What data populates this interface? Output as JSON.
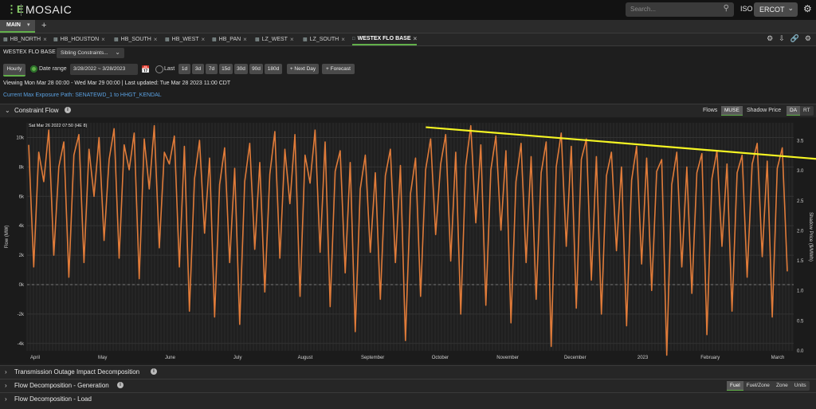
{
  "app": {
    "logo_mark": "⋮E",
    "name": "MOSAIC"
  },
  "search": {
    "placeholder": "Search..."
  },
  "iso": {
    "label": "ISO",
    "value": "ERCOT"
  },
  "main_tab": {
    "label": "MAIN"
  },
  "tabs": [
    "HB_NORTH",
    "HB_HOUSTON",
    "HB_SOUTH",
    "HB_WEST",
    "HB_PAN",
    "LZ_WEST",
    "LZ_SOUTH",
    "WESTEX FLO BASE"
  ],
  "active_tab": "WESTEX FLO BASE",
  "toolbar": {
    "constraint_name": "WESTEX FLO BASE",
    "sibling_select": "Sibling Constraints...",
    "hourly": "Hourly",
    "date_range_label": "Date range",
    "date_range_value": "3/28/2022 ~ 3/28/2023",
    "last_label": "Last",
    "last_options": [
      "1d",
      "3d",
      "7d",
      "15d",
      "30d",
      "90d",
      "180d"
    ],
    "next_day": "+ Next Day",
    "forecast": "+ Forecast"
  },
  "info": {
    "viewing": "Viewing Mon Mar 28 00:00 - Wed Mar 29 00:00 | Last updated: Tue Mar 28 2023 11:00 CDT",
    "exposure_path": "Current Max Exposure Path: SENATEWD_1 to HHGT_KENDAL"
  },
  "constraint_flow": {
    "title": "Constraint Flow",
    "flows_label": "Flows",
    "flows_option": "MUSE",
    "shadow_label": "Shadow Price",
    "shadow_options": [
      "DA",
      "RT"
    ]
  },
  "chart_data": {
    "type": "line",
    "legend_text": "Sat Mar 26 2022 07:50 (HE 8)",
    "ylabel": "Flow (MW)",
    "y2label": "Shadow Price ($/MWh)",
    "ylim": [
      -4500,
      11000
    ],
    "y2lim": [
      0.0,
      3.8
    ],
    "yticks": [
      "10k",
      "8k",
      "6k",
      "4k",
      "2k",
      "0k",
      "-2k",
      "-4k"
    ],
    "y2ticks": [
      "3.5",
      "3.0",
      "2.5",
      "2.0",
      "1.5",
      "1.0",
      "0.5",
      "0.0"
    ],
    "xticks": [
      "April",
      "May",
      "June",
      "July",
      "August",
      "September",
      "October",
      "November",
      "December",
      "2023",
      "February",
      "March"
    ],
    "series_color": "#e07b39",
    "trend_color": "#f5f523",
    "trend": {
      "x": [
        "October",
        "March"
      ],
      "y": [
        10700,
        8500
      ]
    },
    "series": [
      {
        "values": [
          9500,
          1200,
          9000,
          7000,
          10500,
          2000,
          8000,
          9700,
          500,
          8800,
          10200,
          1500,
          9200,
          6000,
          10000,
          3000,
          8500,
          10600,
          1800,
          9500,
          7800,
          10300,
          400,
          9900,
          6500,
          10800,
          2500,
          9000,
          8200,
          10100,
          1200,
          9400,
          -1800,
          7200,
          9800,
          3500,
          8600,
          -2200,
          6800,
          9300,
          1500,
          7900,
          -2700,
          7000,
          9600,
          2400,
          8300,
          -500,
          7500,
          10400,
          1800,
          9200,
          5500,
          10200,
          -800,
          8800,
          6900,
          10500,
          2200,
          9700,
          -1500,
          7700,
          9100,
          800,
          8300,
          -3200,
          6500,
          8800,
          2200,
          7600,
          -1000,
          7400,
          9200,
          1500,
          8100,
          -3800,
          6200,
          8600,
          -800,
          7800,
          9900,
          3400,
          8200,
          10200,
          1600,
          9000,
          -2000,
          8100,
          10800,
          4200,
          9500,
          -1400,
          7800,
          10100,
          3700,
          9100,
          -2600,
          7000,
          9600,
          1500,
          8700,
          -1000,
          7600,
          9700,
          -4200,
          8000,
          10300,
          2600,
          9400,
          -1600,
          8500,
          9900,
          300,
          8700,
          -2000,
          7400,
          9000,
          2300,
          8000,
          -2800,
          7100,
          9400,
          1400,
          8600,
          -400,
          7700,
          8500,
          -4800,
          6800,
          9000,
          1200,
          8000,
          -600,
          7600,
          8900,
          -3400,
          7200,
          9100,
          2600,
          8200,
          -1800,
          7600,
          8800,
          500,
          8200,
          9600,
          1900,
          8400,
          -2200,
          7900,
          9300,
          900
        ]
      }
    ],
    "trend_note": "Yellow arrow annotation drawn from October peak descending to March"
  },
  "sections": [
    {
      "title": "Transmission Outage Impact Decomposition"
    },
    {
      "title": "Flow Decomposition - Generation",
      "options": [
        "Fuel",
        "Fuel/Zone",
        "Zone",
        "Units"
      ]
    },
    {
      "title": "Flow Decomposition - Load"
    }
  ]
}
